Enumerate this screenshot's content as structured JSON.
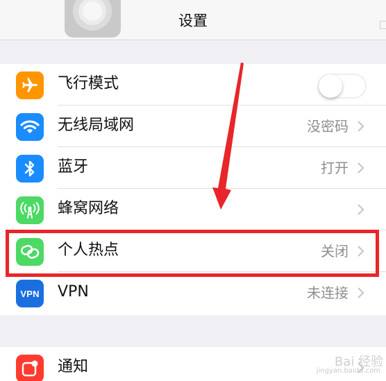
{
  "nav": {
    "title": "设置"
  },
  "settings": [
    {
      "label": "飞行模式",
      "value": "",
      "icon": "airplane-icon",
      "icon_color": "#ff9500",
      "control": "toggle",
      "toggle_on": false
    },
    {
      "label": "无线局域网",
      "value": "没密码",
      "icon": "wifi-icon",
      "icon_color": "#1a8cff",
      "control": "chevron"
    },
    {
      "label": "蓝牙",
      "value": "打开",
      "icon": "bluetooth-icon",
      "icon_color": "#1a8cff",
      "control": "chevron"
    },
    {
      "label": "蜂窝网络",
      "value": "",
      "icon": "cellular-antenna-icon",
      "icon_color": "#4cd964",
      "control": "chevron"
    },
    {
      "label": "个人热点",
      "value": "关闭",
      "icon": "hotspot-link-icon",
      "icon_color": "#4cd964",
      "control": "chevron"
    },
    {
      "label": "VPN",
      "value": "未连接",
      "icon": "vpn-icon",
      "icon_color": "#1a6fe0",
      "icon_text": "VPN",
      "control": "chevron"
    }
  ],
  "settings2": [
    {
      "label": "通知",
      "value": "",
      "icon": "notification-icon",
      "icon_color": "#ff3b30",
      "control": "chevron"
    }
  ],
  "annotation": {
    "highlight_color": "#e8262a",
    "highlighted_item": "个人热点"
  },
  "watermark": {
    "main": "Bai 经验",
    "sub": "jingyan.baidu.com"
  }
}
